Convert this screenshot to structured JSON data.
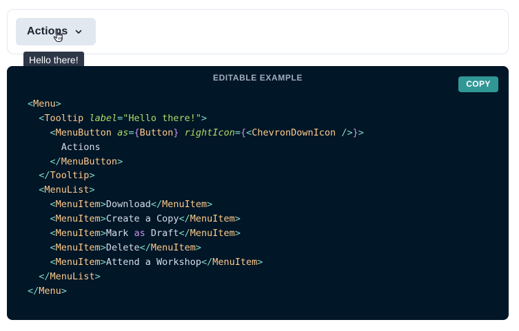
{
  "preview": {
    "menu_button_label": "Actions",
    "tooltip_text": "Hello there!"
  },
  "code_panel": {
    "title": "EDITABLE EXAMPLE",
    "copy_label": "COPY",
    "lines": [
      [
        {
          "t": "punct",
          "v": "<"
        },
        {
          "t": "tag",
          "v": "Menu"
        },
        {
          "t": "punct",
          "v": ">"
        }
      ],
      [
        {
          "t": "plain",
          "v": "  "
        },
        {
          "t": "punct",
          "v": "<"
        },
        {
          "t": "tag",
          "v": "Tooltip"
        },
        {
          "t": "plain",
          "v": " "
        },
        {
          "t": "attr",
          "v": "label"
        },
        {
          "t": "punct",
          "v": "="
        },
        {
          "t": "str",
          "v": "\"Hello there!\""
        },
        {
          "t": "punct",
          "v": ">"
        }
      ],
      [
        {
          "t": "plain",
          "v": "    "
        },
        {
          "t": "punct",
          "v": "<"
        },
        {
          "t": "tag",
          "v": "MenuButton"
        },
        {
          "t": "plain",
          "v": " "
        },
        {
          "t": "attr",
          "v": "as"
        },
        {
          "t": "punct",
          "v": "="
        },
        {
          "t": "bracket",
          "v": "{"
        },
        {
          "t": "tag",
          "v": "Button"
        },
        {
          "t": "bracket",
          "v": "}"
        },
        {
          "t": "plain",
          "v": " "
        },
        {
          "t": "attr",
          "v": "rightIcon"
        },
        {
          "t": "punct",
          "v": "="
        },
        {
          "t": "bracket",
          "v": "{"
        },
        {
          "t": "punct",
          "v": "<"
        },
        {
          "t": "tag",
          "v": "ChevronDownIcon"
        },
        {
          "t": "plain",
          "v": " "
        },
        {
          "t": "punct",
          "v": "/>"
        },
        {
          "t": "bracket",
          "v": "}"
        },
        {
          "t": "punct",
          "v": ">"
        }
      ],
      [
        {
          "t": "plain",
          "v": "      "
        },
        {
          "t": "text",
          "v": "Actions"
        }
      ],
      [
        {
          "t": "plain",
          "v": "    "
        },
        {
          "t": "punct",
          "v": "</"
        },
        {
          "t": "tag",
          "v": "MenuButton"
        },
        {
          "t": "punct",
          "v": ">"
        }
      ],
      [
        {
          "t": "plain",
          "v": "  "
        },
        {
          "t": "punct",
          "v": "</"
        },
        {
          "t": "tag",
          "v": "Tooltip"
        },
        {
          "t": "punct",
          "v": ">"
        }
      ],
      [
        {
          "t": "plain",
          "v": "  "
        },
        {
          "t": "punct",
          "v": "<"
        },
        {
          "t": "tag",
          "v": "MenuList"
        },
        {
          "t": "punct",
          "v": ">"
        }
      ],
      [
        {
          "t": "plain",
          "v": "    "
        },
        {
          "t": "punct",
          "v": "<"
        },
        {
          "t": "tag",
          "v": "MenuItem"
        },
        {
          "t": "punct",
          "v": ">"
        },
        {
          "t": "text",
          "v": "Download"
        },
        {
          "t": "punct",
          "v": "</"
        },
        {
          "t": "tag",
          "v": "MenuItem"
        },
        {
          "t": "punct",
          "v": ">"
        }
      ],
      [
        {
          "t": "plain",
          "v": "    "
        },
        {
          "t": "punct",
          "v": "<"
        },
        {
          "t": "tag",
          "v": "MenuItem"
        },
        {
          "t": "punct",
          "v": ">"
        },
        {
          "t": "text",
          "v": "Create a Copy"
        },
        {
          "t": "punct",
          "v": "</"
        },
        {
          "t": "tag",
          "v": "MenuItem"
        },
        {
          "t": "punct",
          "v": ">"
        }
      ],
      [
        {
          "t": "plain",
          "v": "    "
        },
        {
          "t": "punct",
          "v": "<"
        },
        {
          "t": "tag",
          "v": "MenuItem"
        },
        {
          "t": "punct",
          "v": ">"
        },
        {
          "t": "text",
          "v": "Mark "
        },
        {
          "t": "kw",
          "v": "as"
        },
        {
          "t": "text",
          "v": " Draft"
        },
        {
          "t": "punct",
          "v": "</"
        },
        {
          "t": "tag",
          "v": "MenuItem"
        },
        {
          "t": "punct",
          "v": ">"
        }
      ],
      [
        {
          "t": "plain",
          "v": "    "
        },
        {
          "t": "punct",
          "v": "<"
        },
        {
          "t": "tag",
          "v": "MenuItem"
        },
        {
          "t": "punct",
          "v": ">"
        },
        {
          "t": "text",
          "v": "Delete"
        },
        {
          "t": "punct",
          "v": "</"
        },
        {
          "t": "tag",
          "v": "MenuItem"
        },
        {
          "t": "punct",
          "v": ">"
        }
      ],
      [
        {
          "t": "plain",
          "v": "    "
        },
        {
          "t": "punct",
          "v": "<"
        },
        {
          "t": "tag",
          "v": "MenuItem"
        },
        {
          "t": "punct",
          "v": ">"
        },
        {
          "t": "text",
          "v": "Attend a Workshop"
        },
        {
          "t": "punct",
          "v": "</"
        },
        {
          "t": "tag",
          "v": "MenuItem"
        },
        {
          "t": "punct",
          "v": ">"
        }
      ],
      [
        {
          "t": "plain",
          "v": "  "
        },
        {
          "t": "punct",
          "v": "</"
        },
        {
          "t": "tag",
          "v": "MenuList"
        },
        {
          "t": "punct",
          "v": ">"
        }
      ],
      [
        {
          "t": "punct",
          "v": "</"
        },
        {
          "t": "tag",
          "v": "Menu"
        },
        {
          "t": "punct",
          "v": ">"
        }
      ]
    ]
  },
  "colors": {
    "code_background": "#011627",
    "copy_button": "#319795",
    "tooltip_background": "#2d3748",
    "menu_button_background": "#e2e8f0"
  },
  "icons": {
    "menu_button_icon": "chevron-down-icon",
    "cursor": "hand-pointer-icon"
  }
}
